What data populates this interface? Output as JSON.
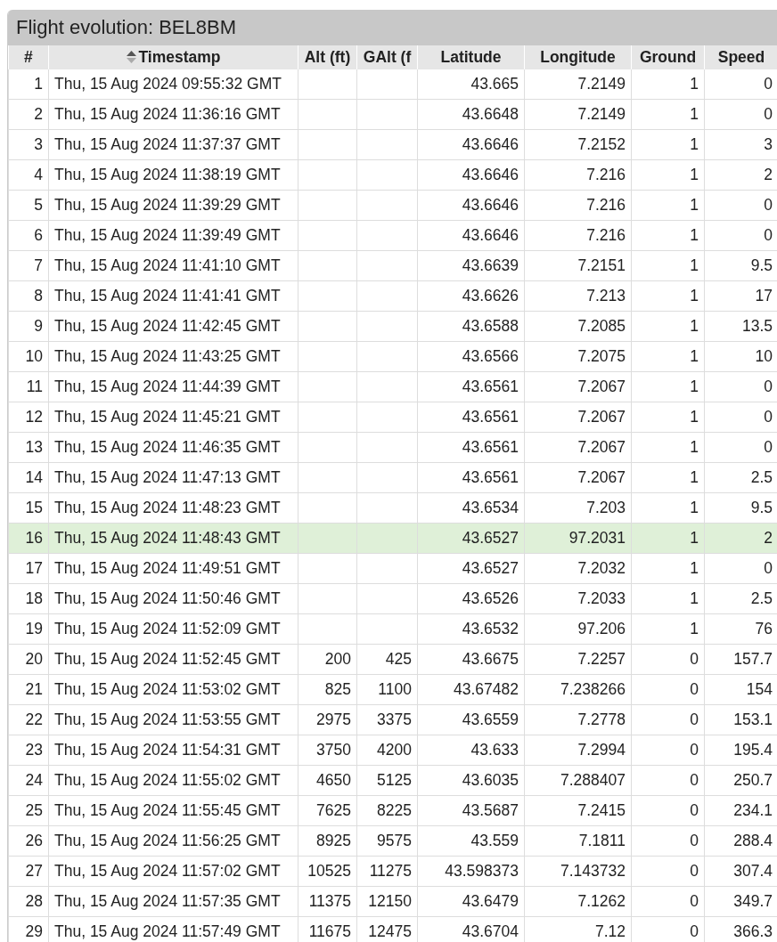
{
  "panel": {
    "title": "Flight evolution: BEL8BM"
  },
  "table": {
    "columns": [
      {
        "label": "#",
        "sortable": false
      },
      {
        "label": "Timestamp",
        "sortable": true
      },
      {
        "label": "Alt (ft)",
        "sortable": false
      },
      {
        "label": "GAlt (f",
        "sortable": false
      },
      {
        "label": "Latitude",
        "sortable": false
      },
      {
        "label": "Longitude",
        "sortable": false
      },
      {
        "label": "Ground",
        "sortable": false
      },
      {
        "label": "Speed",
        "sortable": false
      }
    ],
    "rows": [
      {
        "n": "1",
        "timestamp": "Thu, 15 Aug 2024 09:55:32 GMT",
        "latitude": "43.665",
        "longitude": "7.2149",
        "ground": "1",
        "speed": "0",
        "selected": false
      },
      {
        "n": "2",
        "timestamp": "Thu, 15 Aug 2024 11:36:16 GMT",
        "latitude": "43.6648",
        "longitude": "7.2149",
        "ground": "1",
        "speed": "0",
        "selected": false
      },
      {
        "n": "3",
        "timestamp": "Thu, 15 Aug 2024 11:37:37 GMT",
        "latitude": "43.6646",
        "longitude": "7.2152",
        "ground": "1",
        "speed": "3",
        "selected": false
      },
      {
        "n": "4",
        "timestamp": "Thu, 15 Aug 2024 11:38:19 GMT",
        "latitude": "43.6646",
        "longitude": "7.216",
        "ground": "1",
        "speed": "2",
        "selected": false
      },
      {
        "n": "5",
        "timestamp": "Thu, 15 Aug 2024 11:39:29 GMT",
        "latitude": "43.6646",
        "longitude": "7.216",
        "ground": "1",
        "speed": "0",
        "selected": false
      },
      {
        "n": "6",
        "timestamp": "Thu, 15 Aug 2024 11:39:49 GMT",
        "latitude": "43.6646",
        "longitude": "7.216",
        "ground": "1",
        "speed": "0",
        "selected": false
      },
      {
        "n": "7",
        "timestamp": "Thu, 15 Aug 2024 11:41:10 GMT",
        "latitude": "43.6639",
        "longitude": "7.2151",
        "ground": "1",
        "speed": "9.5",
        "selected": false
      },
      {
        "n": "8",
        "timestamp": "Thu, 15 Aug 2024 11:41:41 GMT",
        "latitude": "43.6626",
        "longitude": "7.213",
        "ground": "1",
        "speed": "17",
        "selected": false
      },
      {
        "n": "9",
        "timestamp": "Thu, 15 Aug 2024 11:42:45 GMT",
        "latitude": "43.6588",
        "longitude": "7.2085",
        "ground": "1",
        "speed": "13.5",
        "selected": false
      },
      {
        "n": "10",
        "timestamp": "Thu, 15 Aug 2024 11:43:25 GMT",
        "latitude": "43.6566",
        "longitude": "7.2075",
        "ground": "1",
        "speed": "10",
        "selected": false
      },
      {
        "n": "11",
        "timestamp": "Thu, 15 Aug 2024 11:44:39 GMT",
        "latitude": "43.6561",
        "longitude": "7.2067",
        "ground": "1",
        "speed": "0",
        "selected": false
      },
      {
        "n": "12",
        "timestamp": "Thu, 15 Aug 2024 11:45:21 GMT",
        "latitude": "43.6561",
        "longitude": "7.2067",
        "ground": "1",
        "speed": "0",
        "selected": false
      },
      {
        "n": "13",
        "timestamp": "Thu, 15 Aug 2024 11:46:35 GMT",
        "latitude": "43.6561",
        "longitude": "7.2067",
        "ground": "1",
        "speed": "0",
        "selected": false
      },
      {
        "n": "14",
        "timestamp": "Thu, 15 Aug 2024 11:47:13 GMT",
        "latitude": "43.6561",
        "longitude": "7.2067",
        "ground": "1",
        "speed": "2.5",
        "selected": false
      },
      {
        "n": "15",
        "timestamp": "Thu, 15 Aug 2024 11:48:23 GMT",
        "latitude": "43.6534",
        "longitude": "7.203",
        "ground": "1",
        "speed": "9.5",
        "selected": false
      },
      {
        "n": "16",
        "timestamp": "Thu, 15 Aug 2024 11:48:43 GMT",
        "latitude": "43.6527",
        "longitude": "97.2031",
        "ground": "1",
        "speed": "2",
        "selected": true
      },
      {
        "n": "17",
        "timestamp": "Thu, 15 Aug 2024 11:49:51 GMT",
        "latitude": "43.6527",
        "longitude": "7.2032",
        "ground": "1",
        "speed": "0",
        "selected": false
      },
      {
        "n": "18",
        "timestamp": "Thu, 15 Aug 2024 11:50:46 GMT",
        "latitude": "43.6526",
        "longitude": "7.2033",
        "ground": "1",
        "speed": "2.5",
        "selected": false
      },
      {
        "n": "19",
        "timestamp": "Thu, 15 Aug 2024 11:52:09 GMT",
        "latitude": "43.6532",
        "longitude": "97.206",
        "ground": "1",
        "speed": "76",
        "selected": false
      },
      {
        "n": "20",
        "timestamp": "Thu, 15 Aug 2024 11:52:45 GMT",
        "alt": "200",
        "galt": "425",
        "latitude": "43.6675",
        "longitude": "7.2257",
        "ground": "0",
        "speed": "157.7",
        "selected": false
      },
      {
        "n": "21",
        "timestamp": "Thu, 15 Aug 2024 11:53:02 GMT",
        "alt": "825",
        "galt": "1100",
        "latitude": "43.67482",
        "longitude": "7.238266",
        "ground": "0",
        "speed": "154",
        "selected": false
      },
      {
        "n": "22",
        "timestamp": "Thu, 15 Aug 2024 11:53:55 GMT",
        "alt": "2975",
        "galt": "3375",
        "latitude": "43.6559",
        "longitude": "7.2778",
        "ground": "0",
        "speed": "153.1",
        "selected": false
      },
      {
        "n": "23",
        "timestamp": "Thu, 15 Aug 2024 11:54:31 GMT",
        "alt": "3750",
        "galt": "4200",
        "latitude": "43.633",
        "longitude": "7.2994",
        "ground": "0",
        "speed": "195.4",
        "selected": false
      },
      {
        "n": "24",
        "timestamp": "Thu, 15 Aug 2024 11:55:02 GMT",
        "alt": "4650",
        "galt": "5125",
        "latitude": "43.6035",
        "longitude": "7.288407",
        "ground": "0",
        "speed": "250.7",
        "selected": false
      },
      {
        "n": "25",
        "timestamp": "Thu, 15 Aug 2024 11:55:45 GMT",
        "alt": "7625",
        "galt": "8225",
        "latitude": "43.5687",
        "longitude": "7.2415",
        "ground": "0",
        "speed": "234.1",
        "selected": false
      },
      {
        "n": "26",
        "timestamp": "Thu, 15 Aug 2024 11:56:25 GMT",
        "alt": "8925",
        "galt": "9575",
        "latitude": "43.559",
        "longitude": "7.1811",
        "ground": "0",
        "speed": "288.4",
        "selected": false
      },
      {
        "n": "27",
        "timestamp": "Thu, 15 Aug 2024 11:57:02 GMT",
        "alt": "10525",
        "galt": "11275",
        "latitude": "43.598373",
        "longitude": "7.143732",
        "ground": "0",
        "speed": "307.4",
        "selected": false
      },
      {
        "n": "28",
        "timestamp": "Thu, 15 Aug 2024 11:57:35 GMT",
        "alt": "11375",
        "galt": "12150",
        "latitude": "43.6479",
        "longitude": "7.1262",
        "ground": "0",
        "speed": "349.7",
        "selected": false
      },
      {
        "n": "29",
        "timestamp": "Thu, 15 Aug 2024 11:57:49 GMT",
        "alt": "11675",
        "galt": "12475",
        "latitude": "43.6704",
        "longitude": "7.12",
        "ground": "0",
        "speed": "366.3",
        "selected": false
      }
    ]
  }
}
